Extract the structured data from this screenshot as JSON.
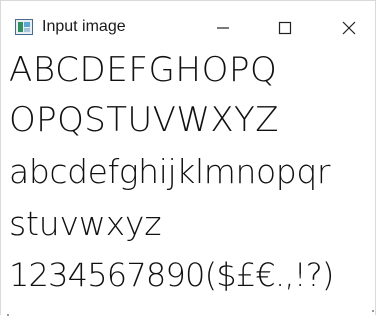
{
  "window": {
    "title": "Input image",
    "icon": "image-viewer-icon"
  },
  "controls": {
    "minimize": "minimize-icon",
    "maximize": "maximize-icon",
    "close": "close-icon"
  },
  "content": {
    "lines": [
      "ABCDEFGHOPQ",
      "OPQSTUVWXYZ",
      "abcdefghijklmnopqr",
      "stuvwxyz",
      "1234567890($£€.,!?)"
    ]
  },
  "colors": {
    "background": "#ffffff",
    "text": "#111111"
  }
}
